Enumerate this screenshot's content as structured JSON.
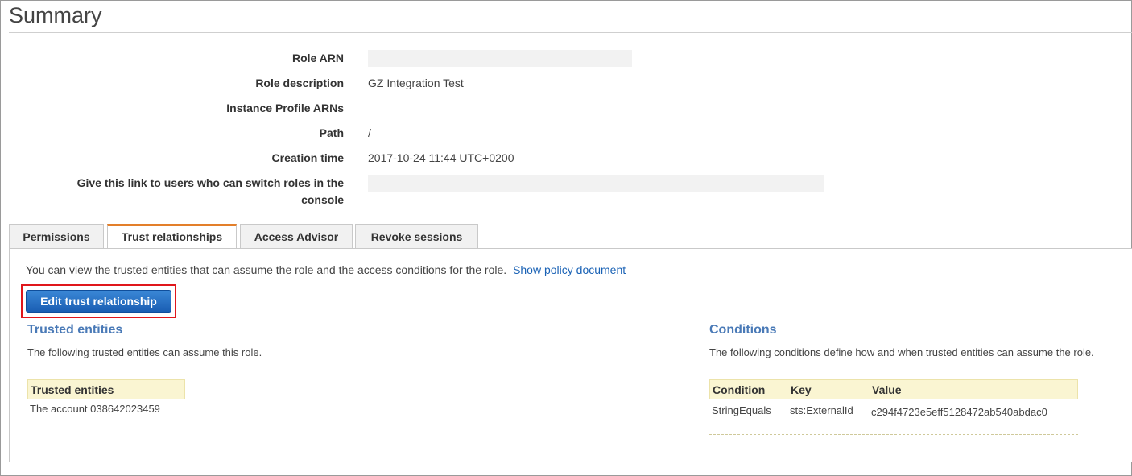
{
  "page": {
    "title": "Summary"
  },
  "summary": {
    "rows": [
      {
        "label": "Role ARN",
        "value": ""
      },
      {
        "label": "Role description",
        "value": "GZ Integration Test"
      },
      {
        "label": "Instance Profile ARNs",
        "value": ""
      },
      {
        "label": "Path",
        "value": "/"
      },
      {
        "label": "Creation time",
        "value": "2017-10-24 11:44 UTC+0200"
      },
      {
        "label_line1": "Give this link to users who can switch roles in the",
        "label_line2": "console",
        "value": ""
      }
    ]
  },
  "tabs": [
    {
      "label": "Permissions",
      "active": false
    },
    {
      "label": "Trust relationships",
      "active": true
    },
    {
      "label": "Access Advisor",
      "active": false
    },
    {
      "label": "Revoke sessions",
      "active": false
    }
  ],
  "trust": {
    "intro": "You can view the trusted entities that can assume the role and the access conditions for the role.",
    "show_policy_link": "Show policy document",
    "edit_button": "Edit trust relationship",
    "trusted": {
      "title": "Trusted entities",
      "description": "The following trusted entities can assume this role.",
      "column": "Trusted entities",
      "rows": [
        "The account 038642023459"
      ]
    },
    "conditions": {
      "title": "Conditions",
      "description": "The following conditions define how and when trusted entities can assume the role.",
      "columns": [
        "Condition",
        "Key",
        "Value"
      ],
      "rows": [
        {
          "condition": "StringEquals",
          "key": "sts:ExternalId",
          "value": "c294f4723e5eff5128472ab540abdac0"
        }
      ]
    }
  },
  "colors": {
    "accent_link": "#1a62b5",
    "section_title": "#4a7ab7",
    "highlight_border": "#e0161b",
    "active_tab_top": "#e37f2a",
    "table_header_bg": "#faf5d2"
  }
}
